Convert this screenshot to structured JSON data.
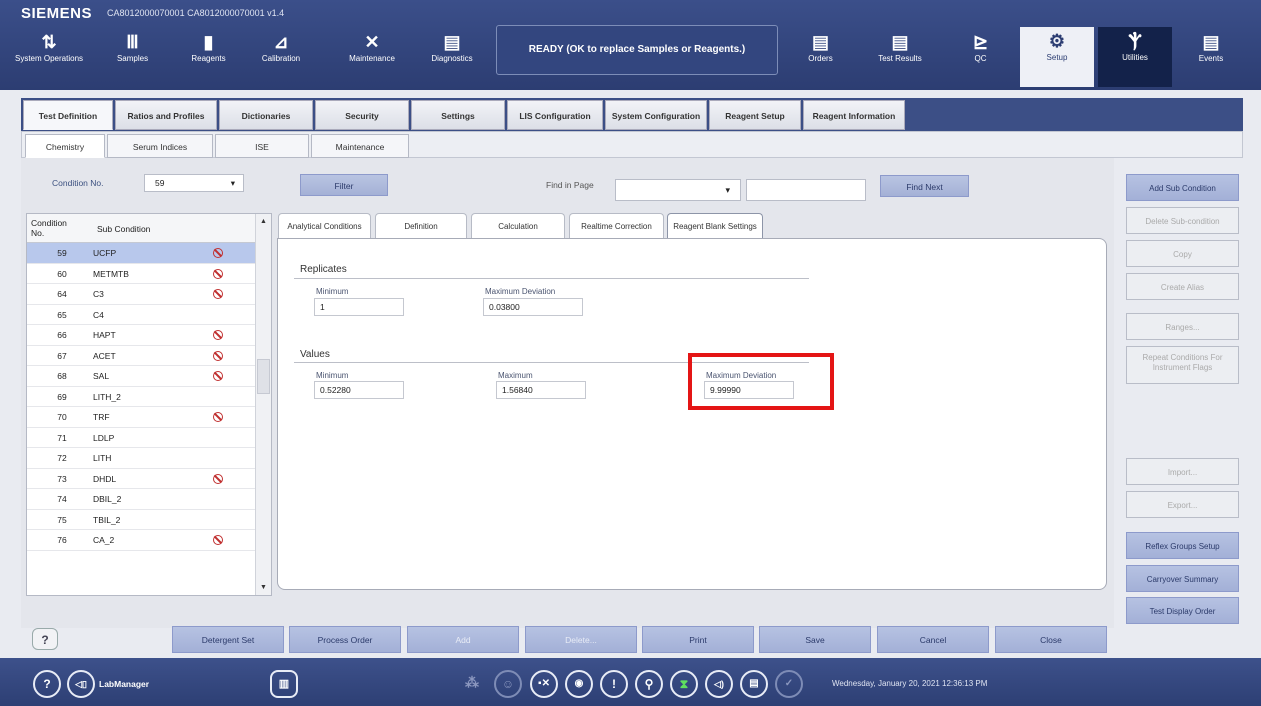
{
  "window": {
    "brand": "SIEMENS",
    "title": "CA8012000070001 CA8012000070001 v1.4"
  },
  "nav": [
    {
      "label": "System Operations",
      "icon": "system-operations-icon",
      "glyph": "⇅"
    },
    {
      "label": "Samples",
      "icon": "samples-icon",
      "glyph": "Ⅲ"
    },
    {
      "label": "Reagents",
      "icon": "reagents-icon",
      "glyph": "▮"
    },
    {
      "label": "Calibration",
      "icon": "calibration-icon",
      "glyph": "⊿"
    },
    {
      "label": "Maintenance",
      "icon": "maintenance-icon",
      "glyph": "✕"
    },
    {
      "label": "Diagnostics",
      "icon": "diagnostics-icon",
      "glyph": "▤"
    },
    {
      "label": "Orders",
      "icon": "orders-icon",
      "glyph": "▤"
    },
    {
      "label": "Test Results",
      "icon": "test-results-icon",
      "glyph": "▤"
    },
    {
      "label": "QC",
      "icon": "qc-icon",
      "glyph": "⊵"
    },
    {
      "label": "Setup",
      "icon": "setup-gears-icon",
      "glyph": "⚙"
    },
    {
      "label": "Utilities",
      "icon": "utilities-icon",
      "glyph": "Ⲯ"
    },
    {
      "label": "Events",
      "icon": "events-icon",
      "glyph": "▤"
    }
  ],
  "status": "READY (OK to replace Samples or Reagents.)",
  "main_tabs": [
    "Test Definition",
    "Ratios and Profiles",
    "Dictionaries",
    "Security",
    "Settings",
    "LIS Configuration",
    "System Configuration",
    "Reagent Setup",
    "Reagent Information"
  ],
  "sub_tabs": [
    "Chemistry",
    "Serum Indices",
    "ISE",
    "Maintenance"
  ],
  "condition": {
    "label": "Condition No.",
    "value": "59"
  },
  "filter_label": "Filter",
  "find": {
    "label": "Find in Page",
    "button": "Find Next"
  },
  "list": {
    "header_no": "Condition No.",
    "header_sub": "Sub Condition",
    "rows": [
      {
        "no": "59",
        "name": "UCFP",
        "flag": true
      },
      {
        "no": "60",
        "name": "METMTB",
        "flag": true
      },
      {
        "no": "64",
        "name": "C3",
        "flag": true
      },
      {
        "no": "65",
        "name": "C4",
        "flag": false
      },
      {
        "no": "66",
        "name": "HAPT",
        "flag": true
      },
      {
        "no": "67",
        "name": "ACET",
        "flag": true
      },
      {
        "no": "68",
        "name": "SAL",
        "flag": true
      },
      {
        "no": "69",
        "name": "LITH_2",
        "flag": false
      },
      {
        "no": "70",
        "name": "TRF",
        "flag": true
      },
      {
        "no": "71",
        "name": "LDLP",
        "flag": false
      },
      {
        "no": "72",
        "name": "LITH",
        "flag": false
      },
      {
        "no": "73",
        "name": "DHDL",
        "flag": true
      },
      {
        "no": "74",
        "name": "DBIL_2",
        "flag": false
      },
      {
        "no": "75",
        "name": "TBIL_2",
        "flag": false
      },
      {
        "no": "76",
        "name": "CA_2",
        "flag": true
      }
    ]
  },
  "detail_tabs": [
    "Analytical Conditions",
    "Definition",
    "Calculation",
    "Realtime Correction",
    "Reagent Blank Settings"
  ],
  "replicates": {
    "title": "Replicates",
    "min_label": "Minimum",
    "min_value": "1",
    "maxdev_label": "Maximum Deviation",
    "maxdev_value": "0.03800"
  },
  "values": {
    "title": "Values",
    "min_label": "Minimum",
    "min_value": "0.52280",
    "max_label": "Maximum",
    "max_value": "1.56840",
    "maxdev_label": "Maximum Deviation",
    "maxdev_value": "9.99990"
  },
  "right_buttons": [
    {
      "label": "Add Sub Condition",
      "on": true
    },
    {
      "label": "Delete Sub-condition",
      "on": false
    },
    {
      "label": "Copy",
      "on": false
    },
    {
      "label": "Create Alias",
      "on": false
    },
    {
      "label": "Ranges...",
      "on": false
    },
    {
      "label": "Repeat Conditions For Instrument Flags",
      "on": false
    },
    {
      "label": "Import...",
      "on": false
    },
    {
      "label": "Export...",
      "on": false
    },
    {
      "label": "Reflex Groups Setup",
      "on": true
    },
    {
      "label": "Carryover Summary",
      "on": true
    },
    {
      "label": "Test Display Order",
      "on": true
    }
  ],
  "bottom_buttons": [
    {
      "label": "Detergent Set",
      "on": true
    },
    {
      "label": "Process Order",
      "on": true
    },
    {
      "label": "Add",
      "on": false
    },
    {
      "label": "Delete...",
      "on": false
    },
    {
      "label": "Print",
      "on": true
    },
    {
      "label": "Save",
      "on": true
    },
    {
      "label": "Cancel",
      "on": true
    },
    {
      "label": "Close",
      "on": true
    }
  ],
  "help_label": "?",
  "footer": {
    "user": "LabManager",
    "datetime": "Wednesday, January 20, 2021 12:36:13 PM"
  }
}
